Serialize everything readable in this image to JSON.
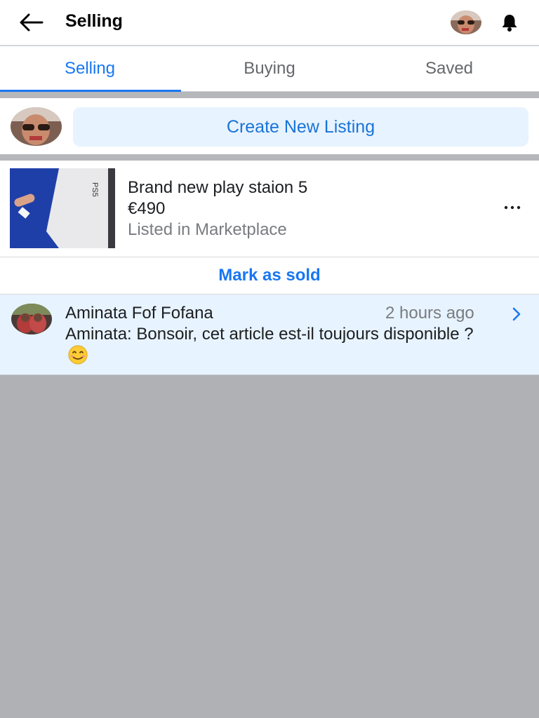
{
  "header": {
    "title": "Selling"
  },
  "tabs": [
    {
      "label": "Selling",
      "active": true
    },
    {
      "label": "Buying",
      "active": false
    },
    {
      "label": "Saved",
      "active": false
    }
  ],
  "create_listing": {
    "button_label": "Create New Listing"
  },
  "listing": {
    "title": "Brand new play staion 5",
    "price": "€490",
    "status": "Listed in Marketplace",
    "thumbnail_text": "PS5"
  },
  "mark_sold": {
    "label": "Mark as sold"
  },
  "message": {
    "name": "Aminata Fof Fofana",
    "time": "2 hours ago",
    "text": "Aminata: Bonsoir, cet article est-il toujours disponible ?",
    "emoji": "smiling-face-emoji"
  },
  "colors": {
    "accent": "#1877f2",
    "create_bg": "#e7f3ff",
    "page_bg": "#afb1b5"
  },
  "icons": {
    "back": "back-arrow-icon",
    "notifications": "bell-icon",
    "more": "more-options-icon",
    "chevron": "chevron-right-icon"
  }
}
